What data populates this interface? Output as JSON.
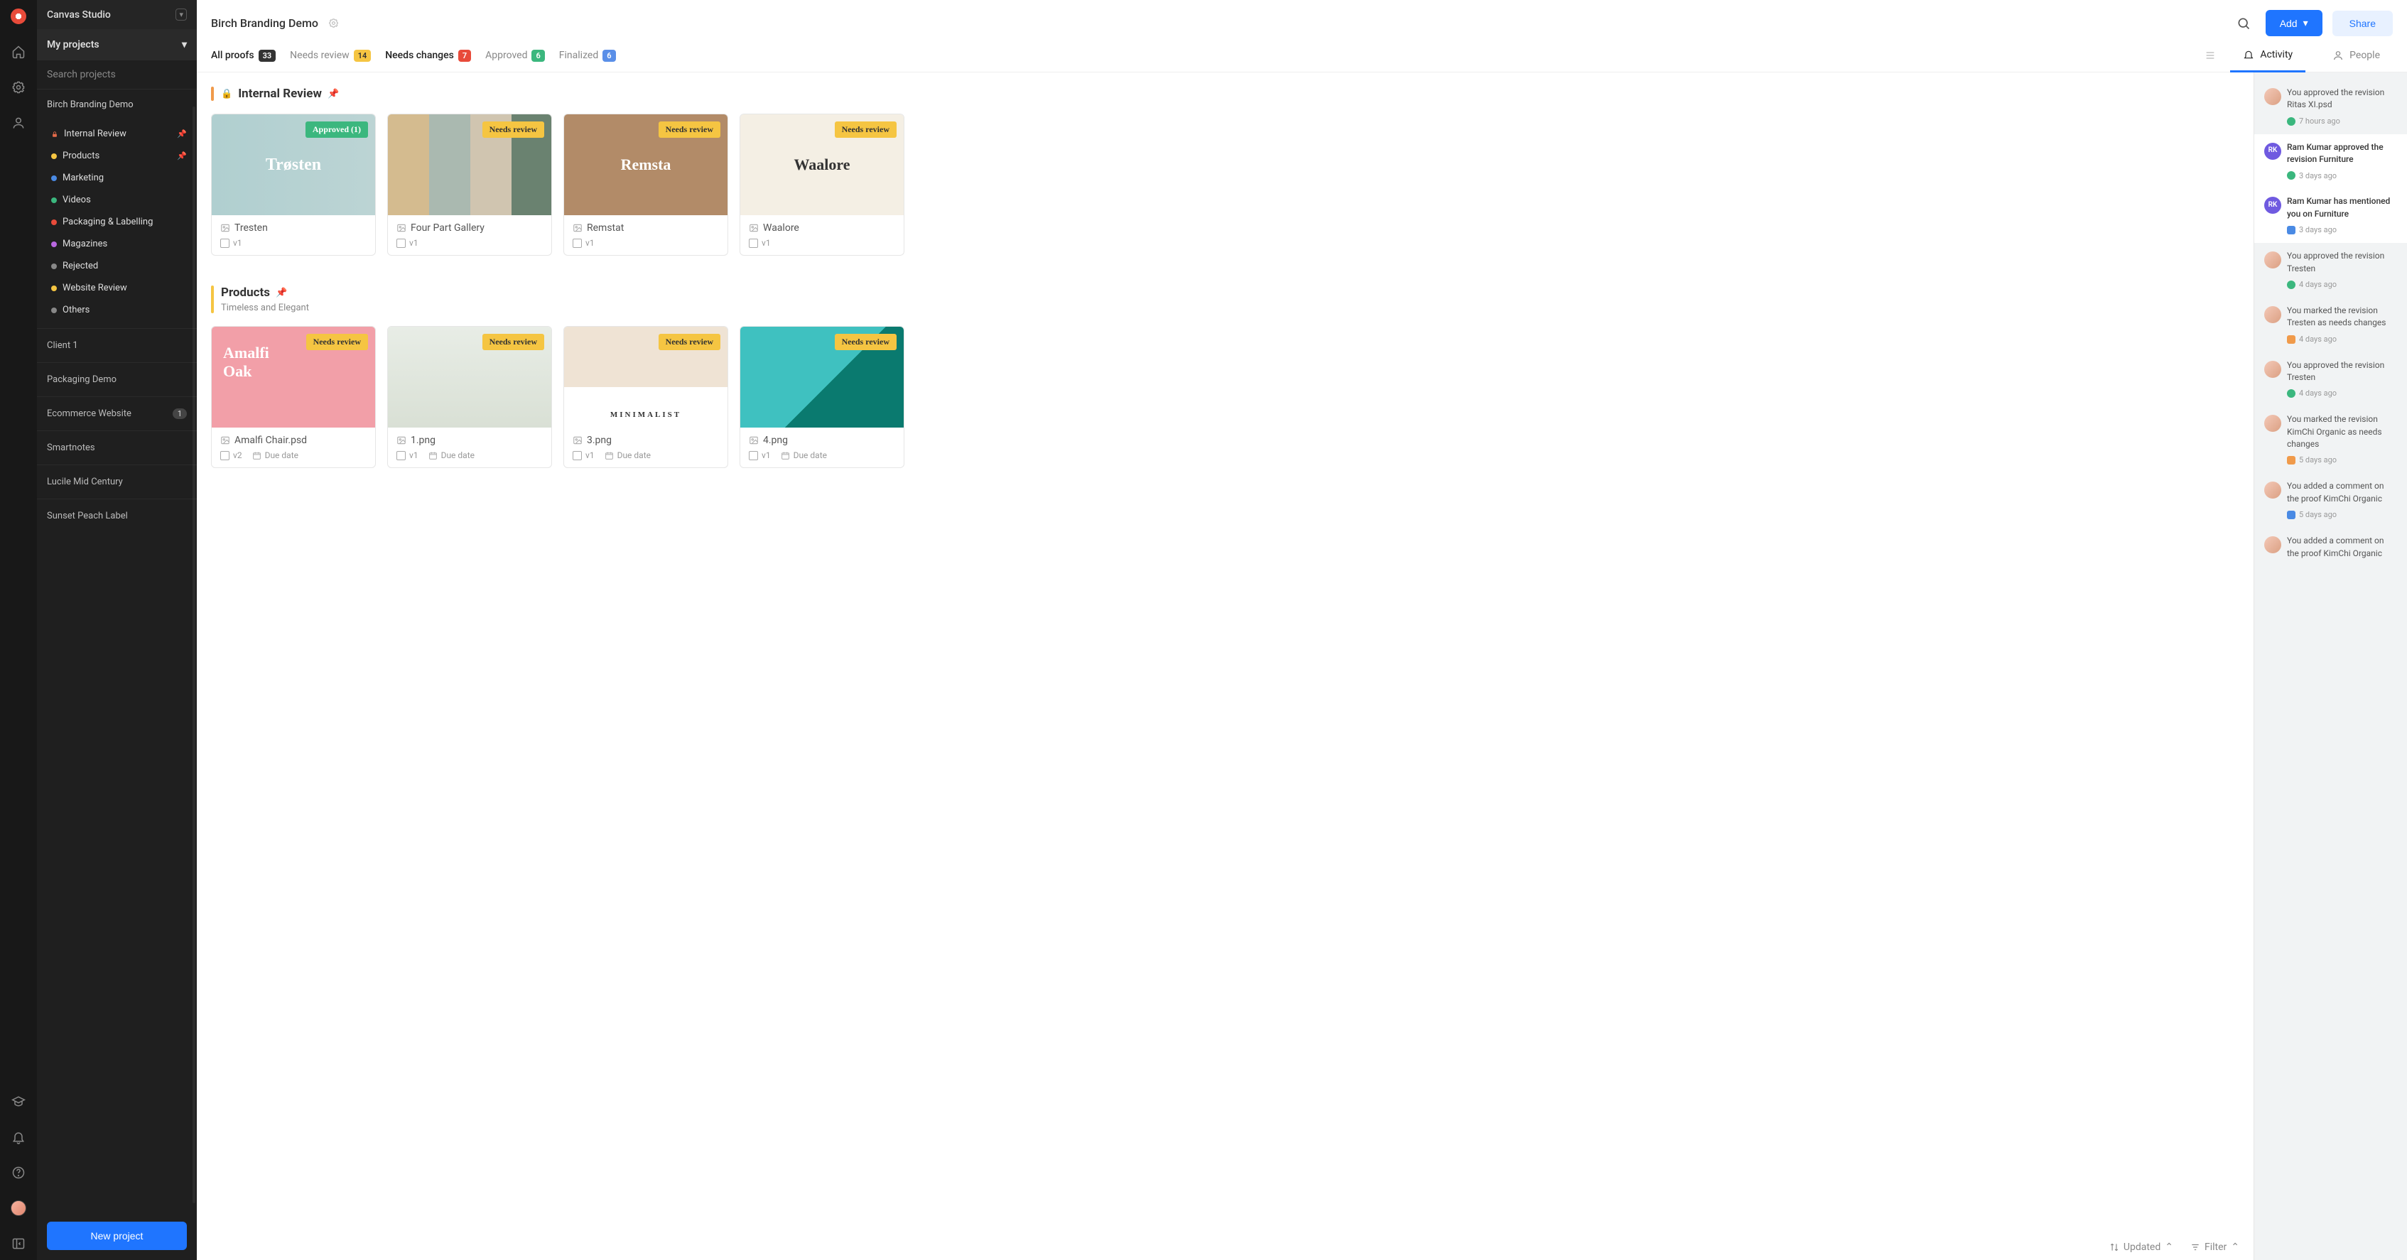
{
  "workspace": {
    "name": "Canvas Studio"
  },
  "sidebar": {
    "my_projects_label": "My projects",
    "search_placeholder": "Search projects",
    "current_project": "Birch Branding Demo",
    "folders": [
      {
        "label": "Internal Review",
        "color": "#e36a4a",
        "locked": true,
        "pinned": true
      },
      {
        "label": "Products",
        "color": "#f5c542",
        "locked": false,
        "pinned": true
      },
      {
        "label": "Marketing",
        "color": "#4a8ae4",
        "locked": false,
        "pinned": false
      },
      {
        "label": "Videos",
        "color": "#3bb77e",
        "locked": false,
        "pinned": false
      },
      {
        "label": "Packaging & Labelling",
        "color": "#e84b3a",
        "locked": false,
        "pinned": false
      },
      {
        "label": "Magazines",
        "color": "#b968e0",
        "locked": false,
        "pinned": false
      },
      {
        "label": "Rejected",
        "color": "#888888",
        "locked": false,
        "pinned": false
      },
      {
        "label": "Website Review",
        "color": "#f5c542",
        "locked": false,
        "pinned": false
      },
      {
        "label": "Others",
        "color": "#888888",
        "locked": false,
        "pinned": false
      }
    ],
    "projects": [
      {
        "label": "Client 1",
        "badge": null
      },
      {
        "label": "Packaging Demo",
        "badge": null
      },
      {
        "label": "Ecommerce Website",
        "badge": "1"
      },
      {
        "label": "Smartnotes",
        "badge": null
      },
      {
        "label": "Lucile Mid Century",
        "badge": null
      },
      {
        "label": "Sunset Peach Label",
        "badge": null
      }
    ],
    "new_project_label": "New project"
  },
  "header": {
    "title": "Birch Branding Demo",
    "add_label": "Add",
    "share_label": "Share"
  },
  "filters": {
    "tabs": [
      {
        "label": "All proofs",
        "count": "33",
        "pill": "pill-dark",
        "active": true
      },
      {
        "label": "Needs review",
        "count": "14",
        "pill": "pill-yellow",
        "active": false
      },
      {
        "label": "Needs changes",
        "count": "7",
        "pill": "pill-red",
        "active": true
      },
      {
        "label": "Approved",
        "count": "6",
        "pill": "pill-green",
        "active": false
      },
      {
        "label": "Finalized",
        "count": "6",
        "pill": "pill-blue",
        "active": false
      }
    ],
    "right_tabs": {
      "activity": "Activity",
      "people": "People"
    }
  },
  "sections": [
    {
      "title": "Internal Review",
      "bar_color": "#f09a4a",
      "locked": true,
      "pinned": true,
      "subtitle": null,
      "cards": [
        {
          "name": "Tresten",
          "version": "v1",
          "status": "Approved (1)",
          "chip": "chip-green",
          "thumb": "thumb-tresten",
          "due": null
        },
        {
          "name": "Four Part Gallery",
          "version": "v1",
          "status": "Needs review",
          "chip": "chip-yellow",
          "thumb": "thumb-fourpart",
          "due": null
        },
        {
          "name": "Remstat",
          "version": "v1",
          "status": "Needs review",
          "chip": "chip-yellow",
          "thumb": "thumb-remsta",
          "due": null
        },
        {
          "name": "Waalore",
          "version": "v1",
          "status": "Needs review",
          "chip": "chip-yellow",
          "thumb": "thumb-waalore",
          "due": null
        }
      ]
    },
    {
      "title": "Products",
      "bar_color": "#f5c542",
      "locked": false,
      "pinned": true,
      "subtitle": "Timeless and Elegant",
      "cards": [
        {
          "name": "Amalfi Chair.psd",
          "version": "v2",
          "status": "Needs review",
          "chip": "chip-yellow",
          "thumb": "thumb-amalfi",
          "due": "Due date"
        },
        {
          "name": "1.png",
          "version": "v1",
          "status": "Needs review",
          "chip": "chip-yellow",
          "thumb": "thumb-1png",
          "due": "Due date"
        },
        {
          "name": "3.png",
          "version": "v1",
          "status": "Needs review",
          "chip": "chip-yellow",
          "thumb": "thumb-3png",
          "due": "Due date"
        },
        {
          "name": "4.png",
          "version": "v1",
          "status": "Needs review",
          "chip": "chip-yellow",
          "thumb": "thumb-4png",
          "due": "Due date"
        }
      ]
    }
  ],
  "toolbar": {
    "updated": "Updated",
    "filter": "Filter"
  },
  "activity": [
    {
      "text": "You approved the revision Ritas XI.psd",
      "time": "7 hours ago",
      "avatar": "user",
      "icon": "dot-green",
      "strong": false
    },
    {
      "text": "Ram Kumar approved the revision Furniture",
      "time": "3 days ago",
      "avatar": "RK",
      "icon": "dot-green",
      "strong": true
    },
    {
      "text": "Ram Kumar has mentioned you on Furniture",
      "time": "3 days ago",
      "avatar": "RK",
      "icon": "dot-blue",
      "strong": true
    },
    {
      "text": "You approved the revision Tresten",
      "time": "4 days ago",
      "avatar": "user",
      "icon": "dot-green",
      "strong": false
    },
    {
      "text": "You marked the revision Tresten as needs changes",
      "time": "4 days ago",
      "avatar": "user",
      "icon": "dot-orange",
      "strong": false
    },
    {
      "text": "You approved the revision Tresten",
      "time": "4 days ago",
      "avatar": "user",
      "icon": "dot-green",
      "strong": false
    },
    {
      "text": "You marked the revision KimChi Organic as needs changes",
      "time": "5 days ago",
      "avatar": "user",
      "icon": "dot-orange",
      "strong": false
    },
    {
      "text": "You added a comment on the proof KimChi Organic",
      "time": "5 days ago",
      "avatar": "user",
      "icon": "dot-blue",
      "strong": false
    },
    {
      "text": "You added a comment on the proof KimChi Organic",
      "time": "",
      "avatar": "user",
      "icon": "dot-blue",
      "strong": false
    }
  ]
}
